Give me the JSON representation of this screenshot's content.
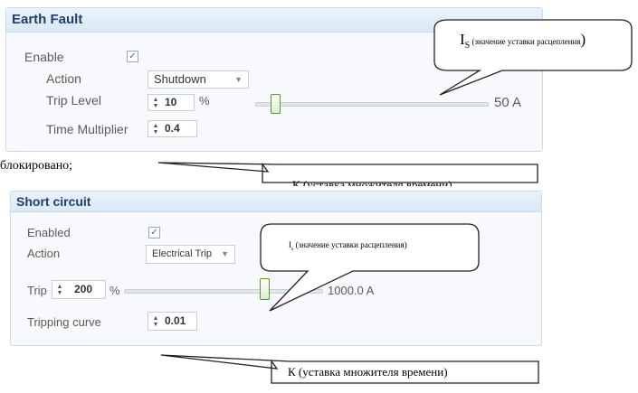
{
  "earth_fault": {
    "title": "Earth Fault",
    "enable_label": "Enable",
    "enable_checked": true,
    "action_label": "Action",
    "action_value": "Shutdown",
    "trip_level_label": "Trip Level",
    "trip_level_value": "10",
    "trip_level_unit": "%",
    "trip_level_fraction": 0.0,
    "trip_current": "50 A",
    "time_multiplier_label": "Time Multiplier",
    "time_multiplier_value": "0.4"
  },
  "short_circuit": {
    "title": "Short circuit",
    "enabled_label": "Enabled",
    "enabled_checked": true,
    "action_label": "Action",
    "action_value": "Electrical Trip",
    "trip_label": "Trip",
    "trip_value": "200",
    "trip_unit": "%",
    "trip_current": "1000.0 A",
    "tripping_curve_label": "Tripping curve",
    "tripping_curve_value": "0.01"
  },
  "annotations": {
    "blocked_text": "блокировано;",
    "callout_is_large_main": "I",
    "callout_is_large_sub": "S",
    "callout_is_large_rest": " (значение уставки   расцепления",
    "callout_is_large_close": ")",
    "callout_k_top": "К (уставка множителя времени)",
    "callout_is_small": "I",
    "callout_is_small_sub": "s",
    "callout_is_small_rest": " (значение уставки расцепления)",
    "callout_k_bottom": "К (уставка множителя времени)"
  },
  "colors": {
    "header_text": "#1f3f66",
    "panel_border": "#c9d9e8",
    "slider_thumb_border": "#4c9a2a",
    "callout_fill": "#ffffff",
    "callout_border": "#222222"
  }
}
